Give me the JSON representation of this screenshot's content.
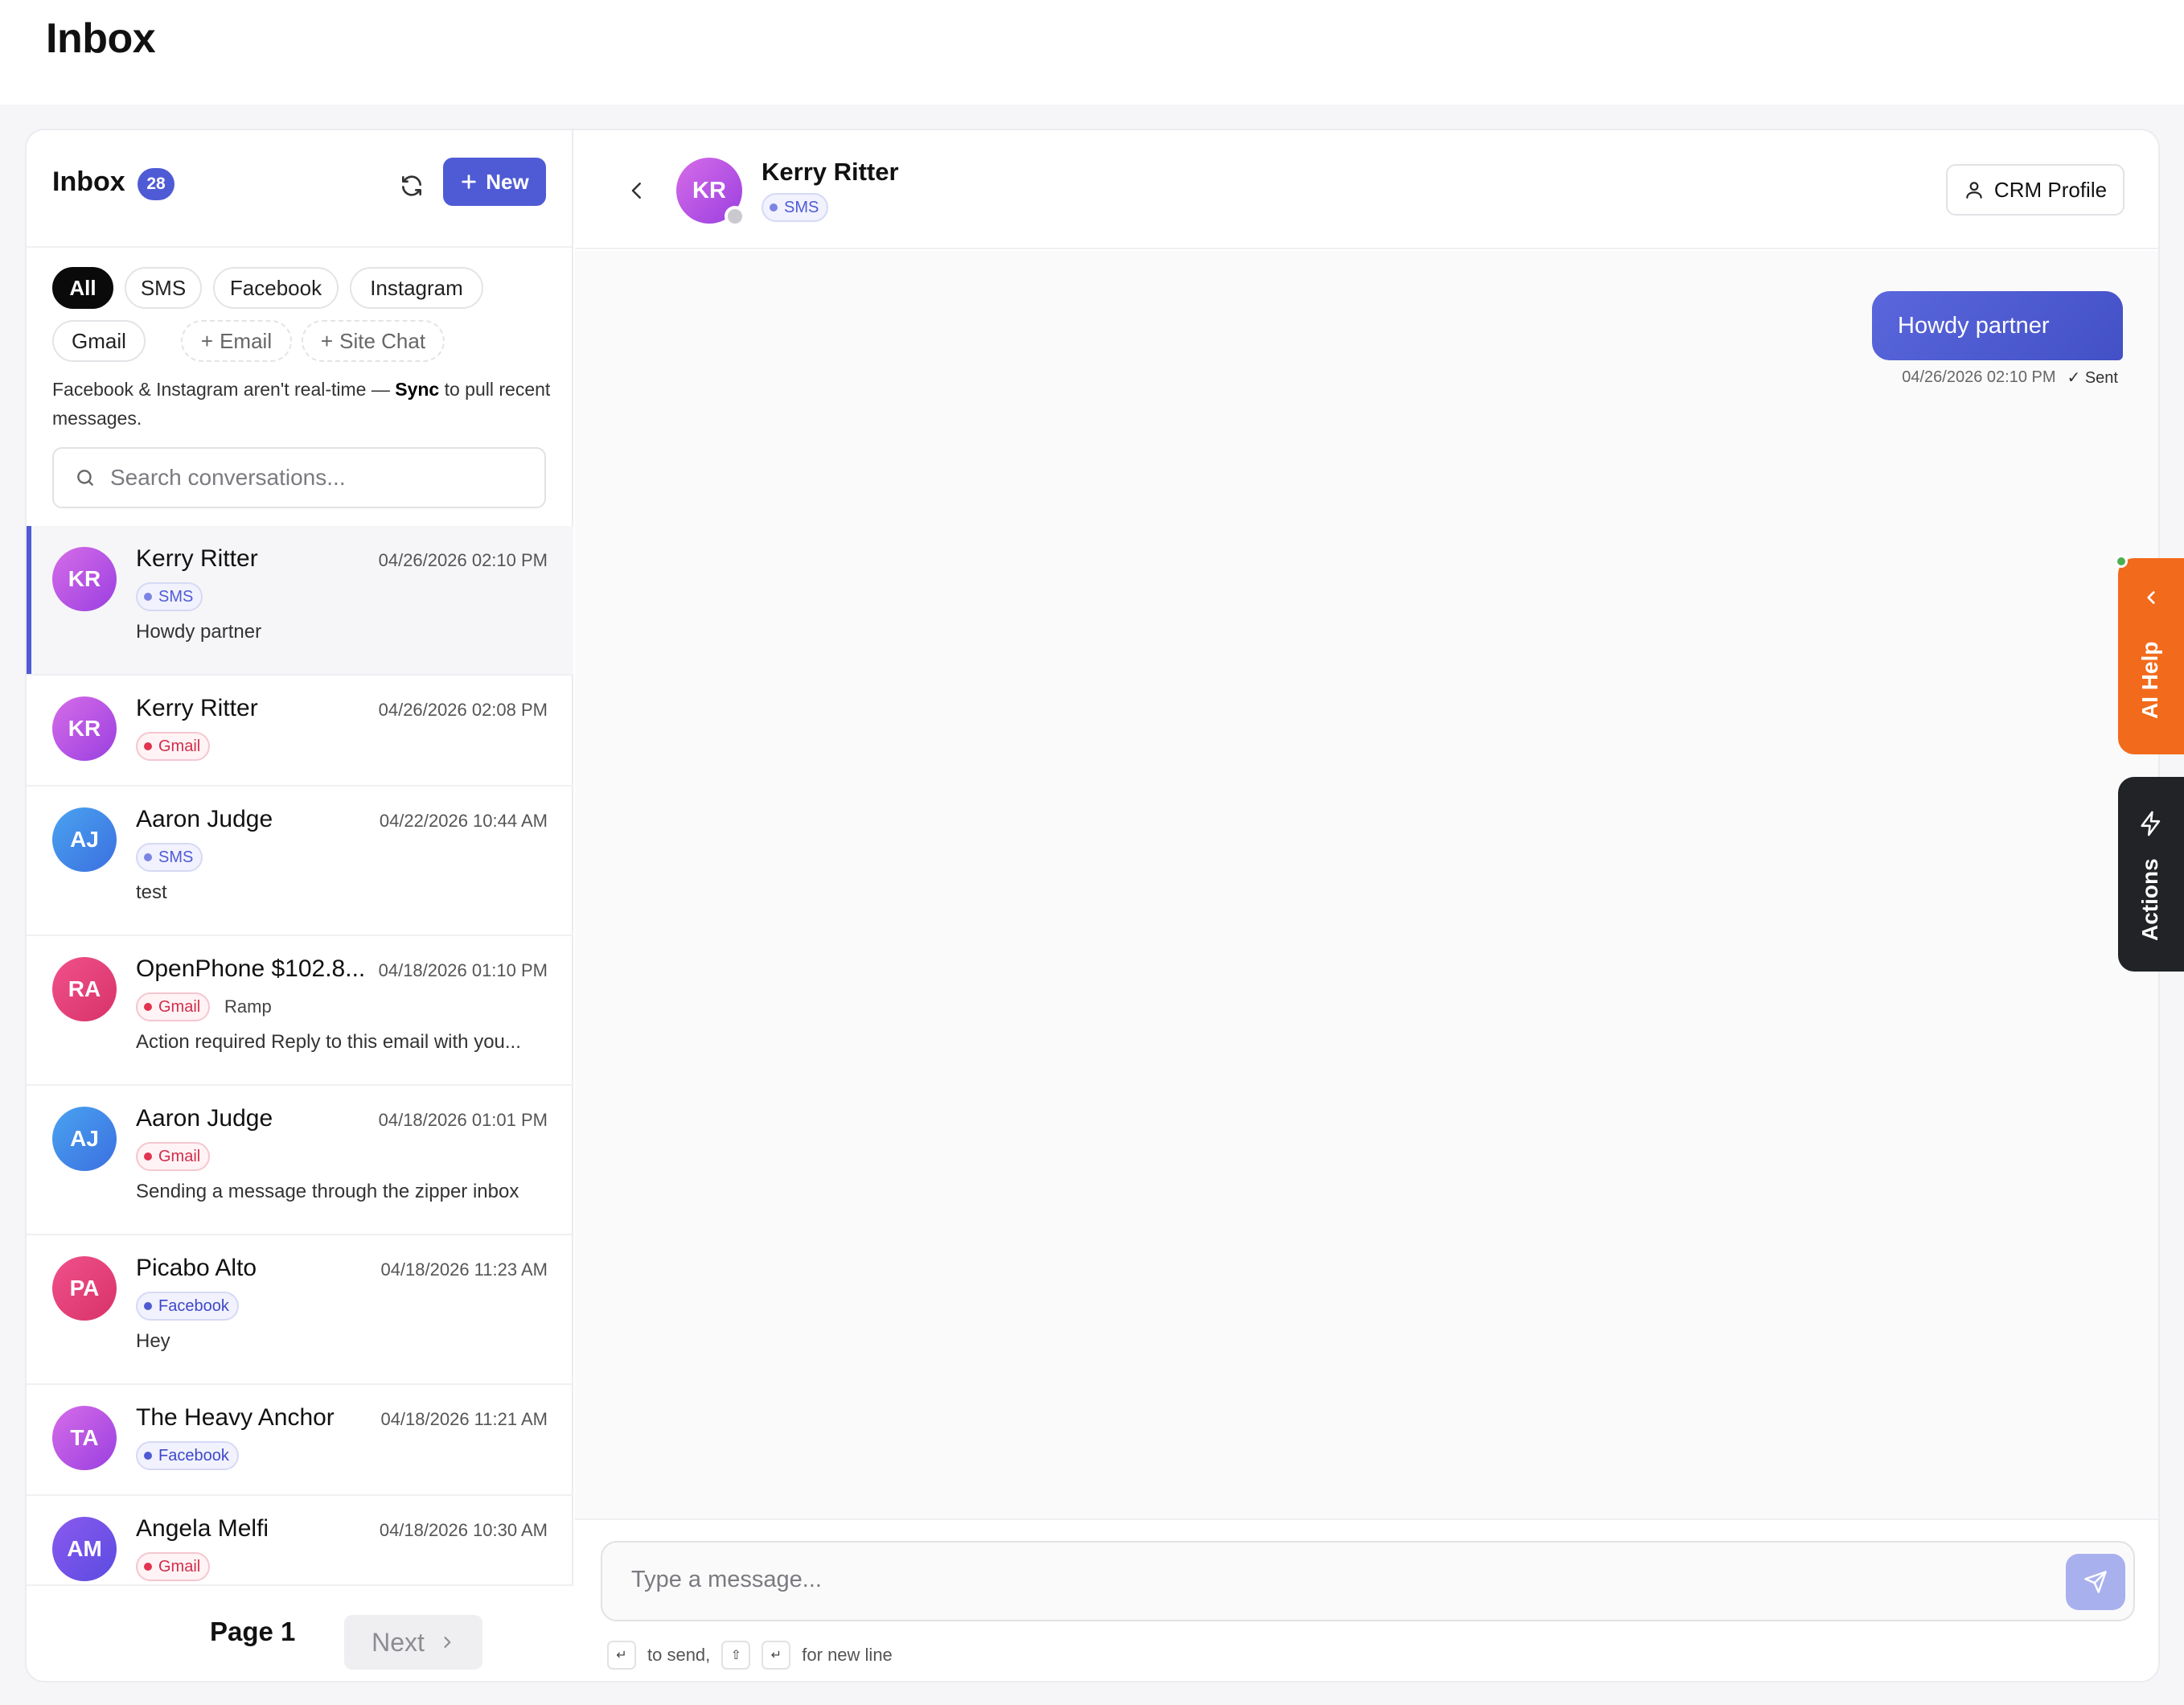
{
  "page": {
    "title": "Inbox"
  },
  "sidebar": {
    "title": "Inbox",
    "count": "28",
    "new_label": "New",
    "filters": [
      {
        "label": "All",
        "active": true
      },
      {
        "label": "SMS"
      },
      {
        "label": "Facebook"
      },
      {
        "label": "Instagram"
      },
      {
        "label": "Gmail"
      },
      {
        "label": "Email",
        "add": true
      },
      {
        "label": "Site Chat",
        "add": true
      }
    ],
    "sync_note_pre": "Facebook & Instagram aren't real-time — ",
    "sync_note_link": "Sync",
    "sync_note_post": " to pull recent messages.",
    "search_placeholder": "Search conversations...",
    "conversations": [
      {
        "initials": "KR",
        "name": "Kerry Ritter",
        "time": "04/26/2026 02:10 PM",
        "channel": "SMS",
        "preview": "Howdy partner",
        "selected": true
      },
      {
        "initials": "KR",
        "name": "Kerry Ritter",
        "time": "04/26/2026 02:08 PM",
        "channel": "Gmail",
        "preview": ""
      },
      {
        "initials": "AJ",
        "name": "Aaron Judge",
        "time": "04/22/2026 10:44 AM",
        "channel": "SMS",
        "preview": "test"
      },
      {
        "initials": "RA",
        "name": "OpenPhone $102.8...",
        "time": "04/18/2026 01:10 PM",
        "channel": "Gmail",
        "from": "Ramp",
        "preview": "Action required Reply to this email with you..."
      },
      {
        "initials": "AJ",
        "name": "Aaron Judge",
        "time": "04/18/2026 01:01 PM",
        "channel": "Gmail",
        "preview": "Sending a message through the zipper inbox"
      },
      {
        "initials": "PA",
        "name": "Picabo Alto",
        "time": "04/18/2026 11:23 AM",
        "channel": "Facebook",
        "preview": "Hey"
      },
      {
        "initials": "TA",
        "name": "The Heavy Anchor",
        "time": "04/18/2026 11:21 AM",
        "channel": "Facebook",
        "preview": ""
      },
      {
        "initials": "AM",
        "name": "Angela Melfi",
        "time": "04/18/2026 10:30 AM",
        "channel": "Gmail",
        "preview": ""
      }
    ],
    "pager": {
      "page_label": "Page 1",
      "next_label": "Next"
    }
  },
  "chat": {
    "contact_initials": "KR",
    "contact_name": "Kerry Ritter",
    "channel": "SMS",
    "crm_label": "CRM Profile",
    "messages": [
      {
        "text": "Howdy partner",
        "time": "04/26/2026 02:10 PM",
        "status": "Sent"
      }
    ],
    "composer_placeholder": "Type a message...",
    "hint_send": "to send,",
    "hint_newline": "for new line"
  },
  "side_tabs": {
    "ai_help": "AI Help",
    "actions": "Actions"
  },
  "colors": {
    "accent": "#4f5bd5",
    "ai_help": "#f26a1b",
    "actions": "#222326"
  }
}
